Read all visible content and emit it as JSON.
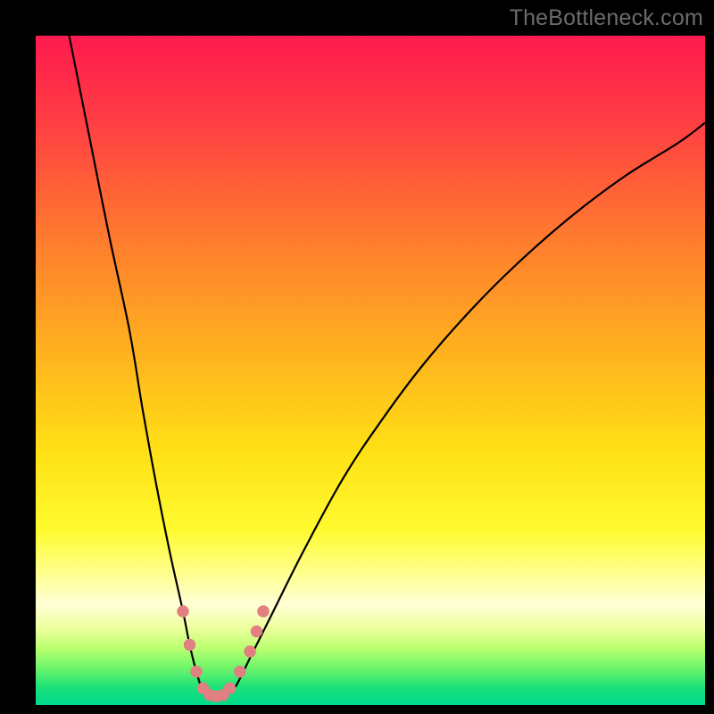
{
  "watermark": "TheBottleneck.com",
  "chart_data": {
    "type": "line",
    "title": "",
    "xlabel": "",
    "ylabel": "",
    "xlim": [
      0,
      100
    ],
    "ylim": [
      0,
      100
    ],
    "background_gradient": {
      "stops": [
        {
          "offset": 0.0,
          "color": "#ff1a4f"
        },
        {
          "offset": 0.12,
          "color": "#ff3b44"
        },
        {
          "offset": 0.3,
          "color": "#ff7a2f"
        },
        {
          "offset": 0.48,
          "color": "#ffb41e"
        },
        {
          "offset": 0.62,
          "color": "#ffe016"
        },
        {
          "offset": 0.74,
          "color": "#fffb30"
        },
        {
          "offset": 0.8,
          "color": "#ffff8a"
        },
        {
          "offset": 0.85,
          "color": "#ffffd6"
        },
        {
          "offset": 0.885,
          "color": "#eeff9c"
        },
        {
          "offset": 0.915,
          "color": "#baff70"
        },
        {
          "offset": 0.945,
          "color": "#6cf56a"
        },
        {
          "offset": 0.975,
          "color": "#18e07a"
        },
        {
          "offset": 1.0,
          "color": "#00d98c"
        }
      ]
    },
    "series": [
      {
        "name": "bottleneck-curve",
        "color": "#000000",
        "x": [
          5,
          8,
          11,
          14,
          16,
          18,
          20,
          22,
          23,
          24,
          25,
          26,
          27,
          28,
          29,
          30,
          32,
          35,
          40,
          46,
          52,
          58,
          65,
          72,
          80,
          88,
          96,
          100
        ],
        "y": [
          100,
          85,
          70,
          56,
          44,
          33,
          23,
          14,
          9,
          5,
          2,
          1,
          1,
          1,
          2,
          3,
          7,
          13,
          23,
          34,
          43,
          51,
          59,
          66,
          73,
          79,
          84,
          87
        ]
      }
    ],
    "markers": {
      "name": "highlight-points",
      "color": "#e08080",
      "radius_plot_units": 0.9,
      "points": [
        {
          "x": 22.0,
          "y": 14.0
        },
        {
          "x": 23.0,
          "y": 9.0
        },
        {
          "x": 24.0,
          "y": 5.0
        },
        {
          "x": 25.0,
          "y": 2.5
        },
        {
          "x": 26.0,
          "y": 1.5
        },
        {
          "x": 27.0,
          "y": 1.3
        },
        {
          "x": 28.0,
          "y": 1.5
        },
        {
          "x": 29.0,
          "y": 2.5
        },
        {
          "x": 30.5,
          "y": 5.0
        },
        {
          "x": 32.0,
          "y": 8.0
        },
        {
          "x": 33.0,
          "y": 11.0
        },
        {
          "x": 34.0,
          "y": 14.0
        }
      ]
    }
  }
}
